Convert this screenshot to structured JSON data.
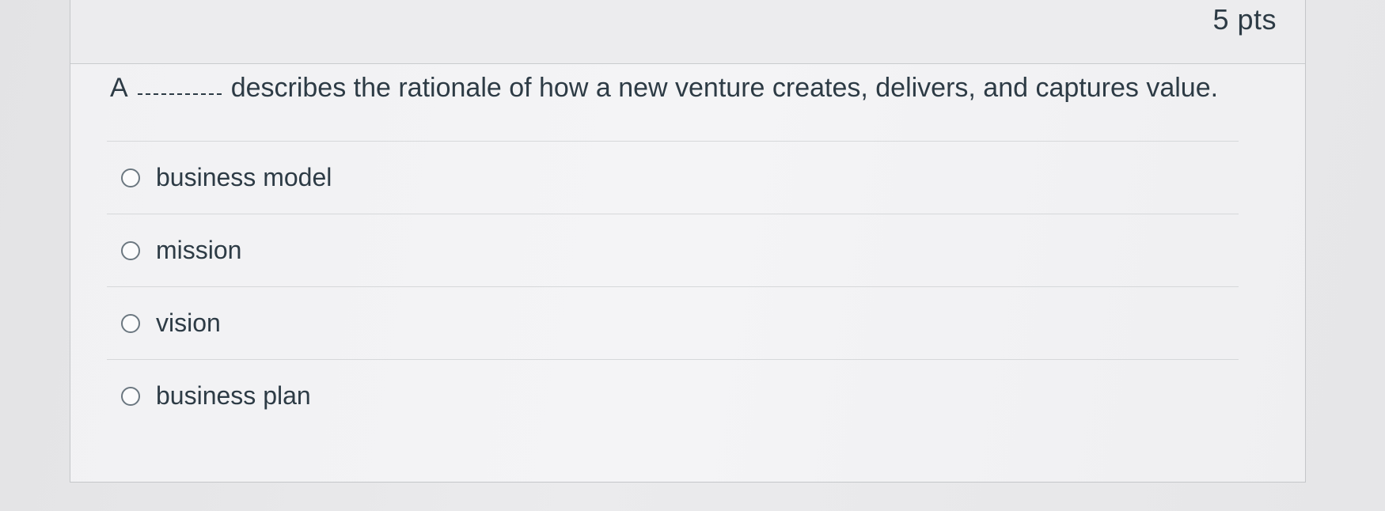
{
  "question": {
    "points": "5 pts",
    "article": "A",
    "text": "describes the rationale of how a new venture creates, delivers, and captures value."
  },
  "answers": [
    {
      "label": "business model",
      "selected": false
    },
    {
      "label": "mission",
      "selected": false
    },
    {
      "label": "vision",
      "selected": false
    },
    {
      "label": "business plan",
      "selected": false
    }
  ],
  "colors": {
    "text": "#2d3b45",
    "border": "#c4c6c9",
    "radio": "#6b7780"
  }
}
